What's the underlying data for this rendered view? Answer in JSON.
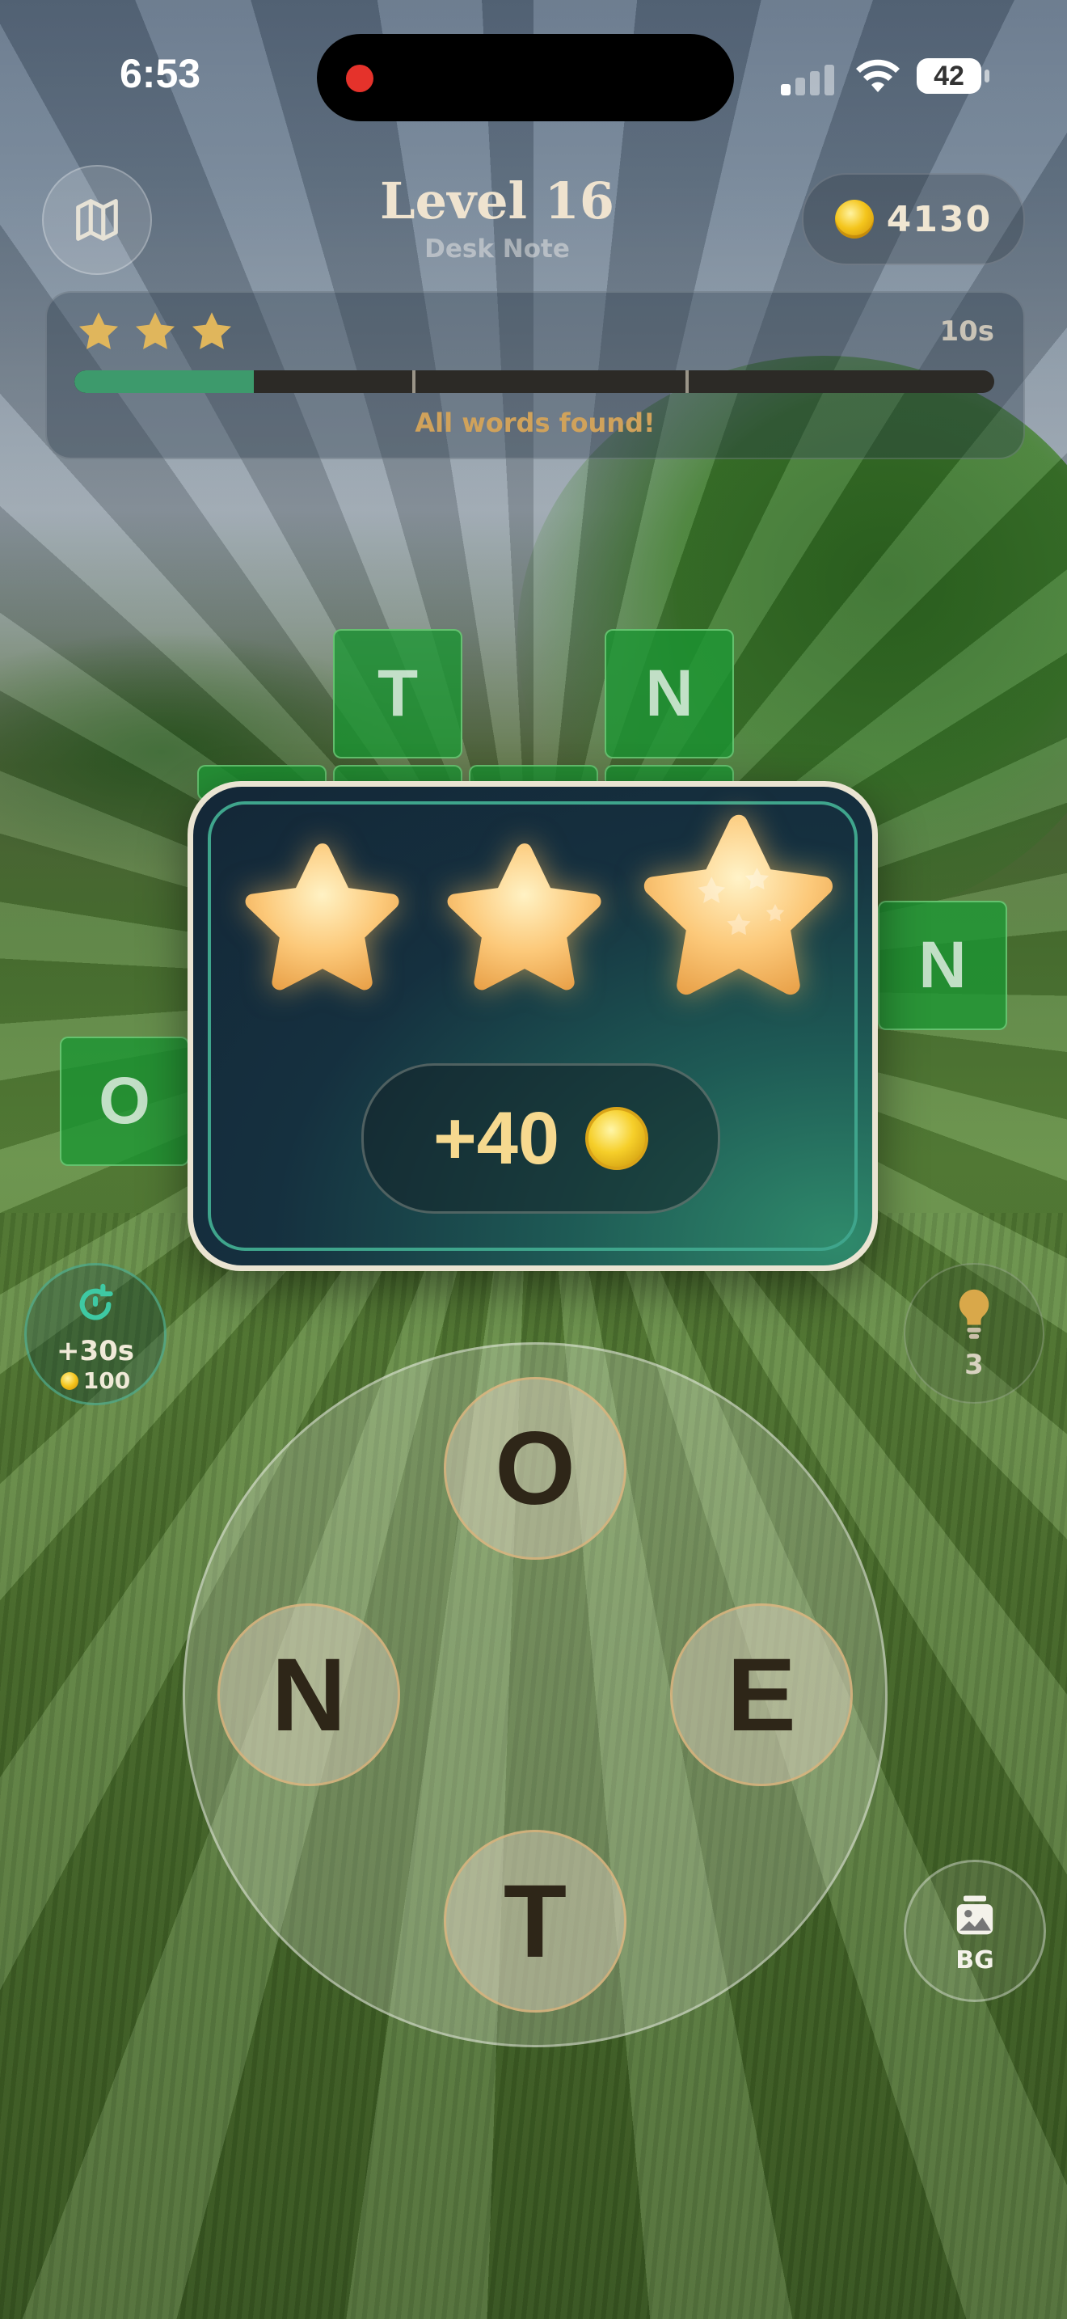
{
  "status_bar": {
    "time": "6:53",
    "battery": "42"
  },
  "header": {
    "title": "Level 16",
    "subtitle": "Desk Note",
    "coins": "4130"
  },
  "progress": {
    "stars_earned": 3,
    "time_left": "10s",
    "fill_fraction": 0.195,
    "message": "All words found!"
  },
  "board": {
    "tiles": [
      "T",
      "N",
      "N",
      "O"
    ]
  },
  "reward_modal": {
    "stars": 3,
    "reward": "+40"
  },
  "side_buttons": {
    "time_boost_label": "+30s",
    "time_boost_cost": "100",
    "hint_count": "3",
    "background_label": "BG"
  },
  "letter_wheel": {
    "letters": [
      "O",
      "N",
      "E",
      "T"
    ]
  },
  "colors": {
    "tile_green": "#1f9a3a",
    "accent_gold": "#f6d98f",
    "progress_fill": "#3d9a6c",
    "message_gold": "#d0a25b"
  }
}
